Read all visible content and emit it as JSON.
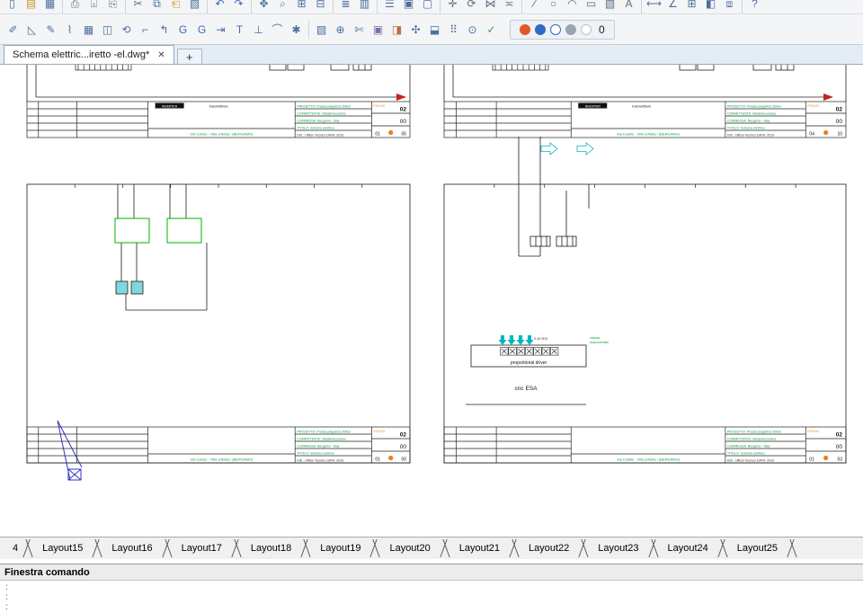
{
  "doc_tabs": {
    "active_title": "Schema elettric...iretto -el.dwg*",
    "close_glyph": "✕",
    "new_tab_glyph": "+"
  },
  "toolbars": {
    "row1": [
      {
        "name": "qnew",
        "glyph": "▯",
        "color": "#4d6f9d"
      },
      {
        "name": "open",
        "glyph": "▤",
        "color": "#c9972f"
      },
      {
        "name": "save",
        "glyph": "▦",
        "color": "#4d6f9d"
      },
      {
        "sep": true
      },
      {
        "name": "plot",
        "glyph": "⎙",
        "color": "#5a6e84"
      },
      {
        "name": "plot-preview",
        "glyph": "⌻",
        "color": "#5a6e84"
      },
      {
        "name": "publish",
        "glyph": "⎘",
        "color": "#5a6e84"
      },
      {
        "sep": true
      },
      {
        "name": "cut",
        "glyph": "✂",
        "color": "#5a6e84"
      },
      {
        "name": "copy-clip",
        "glyph": "⧉",
        "color": "#4d6f9d"
      },
      {
        "name": "paste",
        "glyph": "⎗",
        "color": "#c9972f"
      },
      {
        "name": "match-properties",
        "glyph": "▨",
        "color": "#4d6f9d"
      },
      {
        "sep": true
      },
      {
        "name": "undo",
        "glyph": "↶",
        "color": "#3c6bb3"
      },
      {
        "name": "redo",
        "glyph": "↷",
        "color": "#3c6bb3"
      },
      {
        "sep": true
      },
      {
        "name": "pan",
        "glyph": "✥",
        "color": "#4d6f9d"
      },
      {
        "name": "zoom-realtime",
        "glyph": "⌕",
        "color": "#4d6f9d"
      },
      {
        "name": "zoom-window",
        "glyph": "⊞",
        "color": "#4d6f9d"
      },
      {
        "name": "zoom-previous",
        "glyph": "⊟",
        "color": "#4d6f9d"
      },
      {
        "sep": true
      },
      {
        "name": "layer-manager",
        "glyph": "≣",
        "color": "#4d6f9d"
      },
      {
        "name": "layer-states",
        "glyph": "▥",
        "color": "#4d6f9d"
      },
      {
        "sep": true
      },
      {
        "name": "properties",
        "glyph": "☰",
        "color": "#4d6f9d"
      },
      {
        "name": "design-center",
        "glyph": "▣",
        "color": "#4d6f9d"
      },
      {
        "name": "tool-palettes",
        "glyph": "▢",
        "color": "#4d6f9d"
      },
      {
        "sep": true
      },
      {
        "name": "move",
        "glyph": "✛",
        "color": "#5a6e84"
      },
      {
        "name": "rotate",
        "glyph": "⟳",
        "color": "#5a6e84"
      },
      {
        "name": "mirror",
        "glyph": "⋈",
        "color": "#5a6e84"
      },
      {
        "name": "offset",
        "glyph": "≍",
        "color": "#5a6e84"
      },
      {
        "sep": true
      },
      {
        "name": "line",
        "glyph": "∕",
        "color": "#5a6e84"
      },
      {
        "name": "circle",
        "glyph": "○",
        "color": "#5a6e84"
      },
      {
        "name": "arc",
        "glyph": "◠",
        "color": "#5a6e84"
      },
      {
        "name": "rectangle",
        "glyph": "▭",
        "color": "#5a6e84"
      },
      {
        "name": "hatch",
        "glyph": "▧",
        "color": "#5a6e84"
      },
      {
        "name": "text-tool",
        "glyph": "A",
        "color": "#5a6e84"
      },
      {
        "sep": true
      },
      {
        "name": "dim-linear",
        "glyph": "⟷",
        "color": "#4d6f9d"
      },
      {
        "name": "dim-angular",
        "glyph": "∠",
        "color": "#4d6f9d"
      },
      {
        "name": "table",
        "glyph": "⊞",
        "color": "#4d6f9d"
      },
      {
        "name": "block-insert",
        "glyph": "◧",
        "color": "#4d6f9d"
      },
      {
        "name": "xref",
        "glyph": "⧈",
        "color": "#4d6f9d"
      },
      {
        "sep": true
      },
      {
        "name": "help",
        "glyph": "?",
        "color": "#4d6f9d"
      }
    ],
    "row2": [
      {
        "name": "select",
        "glyph": "✐",
        "color": "#4d6f9d"
      },
      {
        "name": "erase",
        "glyph": "◺",
        "color": "#4d6f9d"
      },
      {
        "name": "sketch",
        "glyph": "✎",
        "color": "#4d6f9d"
      },
      {
        "name": "region",
        "glyph": "⌇",
        "color": "#4d6f9d"
      },
      {
        "name": "grid-display",
        "glyph": "▦",
        "color": "#4d6f9d"
      },
      {
        "name": "snap-mode",
        "glyph": "◫",
        "color": "#4d6f9d"
      },
      {
        "name": "revcloud",
        "glyph": "⟲",
        "color": "#4d6f9d"
      },
      {
        "name": "ucs",
        "glyph": "⌐",
        "color": "#4d6f9d"
      },
      {
        "name": "ucs-previous",
        "glyph": "↰",
        "color": "#4d6f9d"
      },
      {
        "name": "ucs-world",
        "glyph": "G",
        "color": "#3c6bb3"
      },
      {
        "name": "ucs-object",
        "glyph": "G",
        "color": "#3c6bb3"
      },
      {
        "name": "ucs-face",
        "glyph": "⇥",
        "color": "#4d6f9d"
      },
      {
        "name": "text-style",
        "glyph": "T",
        "color": "#3c6bb3"
      },
      {
        "name": "perpendicular",
        "glyph": "⊥",
        "color": "#4d6f9d"
      },
      {
        "name": "tangent",
        "glyph": "⌒",
        "color": "#4d6f9d"
      },
      {
        "name": "node",
        "glyph": "✱",
        "color": "#4d6f9d"
      },
      {
        "sep": true
      },
      {
        "name": "edit-block",
        "glyph": "▧",
        "color": "#4d6f9d"
      },
      {
        "name": "attach",
        "glyph": "⊕",
        "color": "#4d6f9d"
      },
      {
        "name": "clip",
        "glyph": "✄",
        "color": "#4d6f9d"
      },
      {
        "name": "render",
        "glyph": "▣",
        "color": "#7b6fa0"
      },
      {
        "name": "materials",
        "glyph": "◨",
        "color": "#c06a4a"
      },
      {
        "name": "lights",
        "glyph": "✣",
        "color": "#4d6f9d"
      },
      {
        "name": "camera",
        "glyph": "⬓",
        "color": "#4d6f9d"
      },
      {
        "name": "motion",
        "glyph": "⠿",
        "color": "#4d6f9d"
      },
      {
        "name": "sun",
        "glyph": "⊙",
        "color": "#4d6f9d"
      },
      {
        "name": "check",
        "glyph": "✓",
        "color": "#3da04a"
      }
    ],
    "right_group": {
      "dots": [
        {
          "name": "layer-color-orange",
          "color": "#e05a28",
          "fill": true
        },
        {
          "name": "layer-color-blue",
          "color": "#2f6bc4",
          "fill": true
        },
        {
          "name": "layer-color-blue-outline",
          "color": "#2f6bc4",
          "fill": false
        },
        {
          "name": "layer-lock",
          "color": "#9aa4ae",
          "fill": true
        },
        {
          "name": "layer-color-white",
          "color": "#b9bfc6",
          "fill": false
        }
      ],
      "value": "0"
    }
  },
  "drawing": {
    "title_block": {
      "address": "Via Colello - Villa d'Adda / (BERGAMO)",
      "info_lines": [
        "PROGETTO:  Pressa piegatrice 60ton",
        "COMMITTENTE:  Metalmeccanica",
        "COMMESSA:  Bergamo - Italy",
        "TITOLO:  Schema elettrico",
        "DIS.: Ufficio Tecnico   DATA: 2019"
      ],
      "foglio_label": "FOGLIO"
    },
    "device_labels": {
      "label1": "INVERTER",
      "label2": "trasmettitore"
    },
    "sheets": {
      "top_left": {
        "n1": "02",
        "n2": "00",
        "n3": "01",
        "n4": "05"
      },
      "top_right": {
        "n1": "02",
        "n2": "00",
        "n3": "04",
        "n4": "10"
      },
      "bottom_left": {
        "n1": "02",
        "n2": "00",
        "n3": "01",
        "n4": "00"
      },
      "bottom_right": {
        "n1": "02",
        "n2": "00",
        "n3": "01",
        "n4": "03"
      }
    },
    "cnc_label": "cnc ESA",
    "driver_label": "proportional driver",
    "driver_signal": "0-10 VDC",
    "valve_label_1": "valvola",
    "valve_label_2": "proporzionale"
  },
  "layout_bar": {
    "partial_tab": "4",
    "tabs": [
      "Layout15",
      "Layout16",
      "Layout17",
      "Layout18",
      "Layout19",
      "Layout20",
      "Layout21",
      "Layout22",
      "Layout23",
      "Layout24",
      "Layout25"
    ]
  },
  "command_window": {
    "title": "Finestra comando",
    "lines": [
      ":",
      ":",
      ":"
    ]
  }
}
